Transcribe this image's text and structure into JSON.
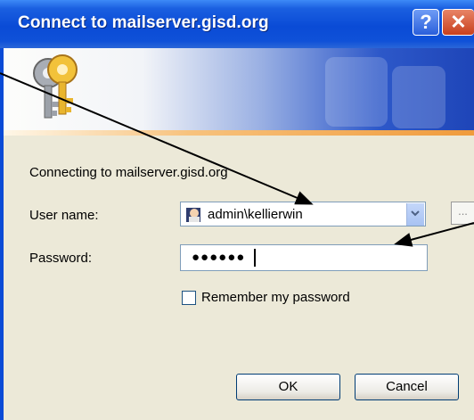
{
  "window": {
    "title": "Connect to mailserver.gisd.org",
    "help_glyph": "?",
    "close_glyph": "✕"
  },
  "body": {
    "connecting_text": "Connecting to mailserver.gisd.org",
    "username_label": "User name:",
    "username_value": "admin\\kellierwin",
    "password_label": "Password:",
    "password_value": "●●●●●●",
    "remember_label": "Remember my password",
    "remember_checked": false,
    "browse_glyph": "..."
  },
  "buttons": {
    "ok_label": "OK",
    "cancel_label": "Cancel"
  },
  "colors": {
    "titlebar": "#0a4bd6",
    "dialog_bg": "#ece9d8",
    "accent_orange": "#f09b3c"
  },
  "icons": {
    "banner": "keys-icon",
    "user": "user-account-icon",
    "dropdown": "chevron-down-icon"
  }
}
